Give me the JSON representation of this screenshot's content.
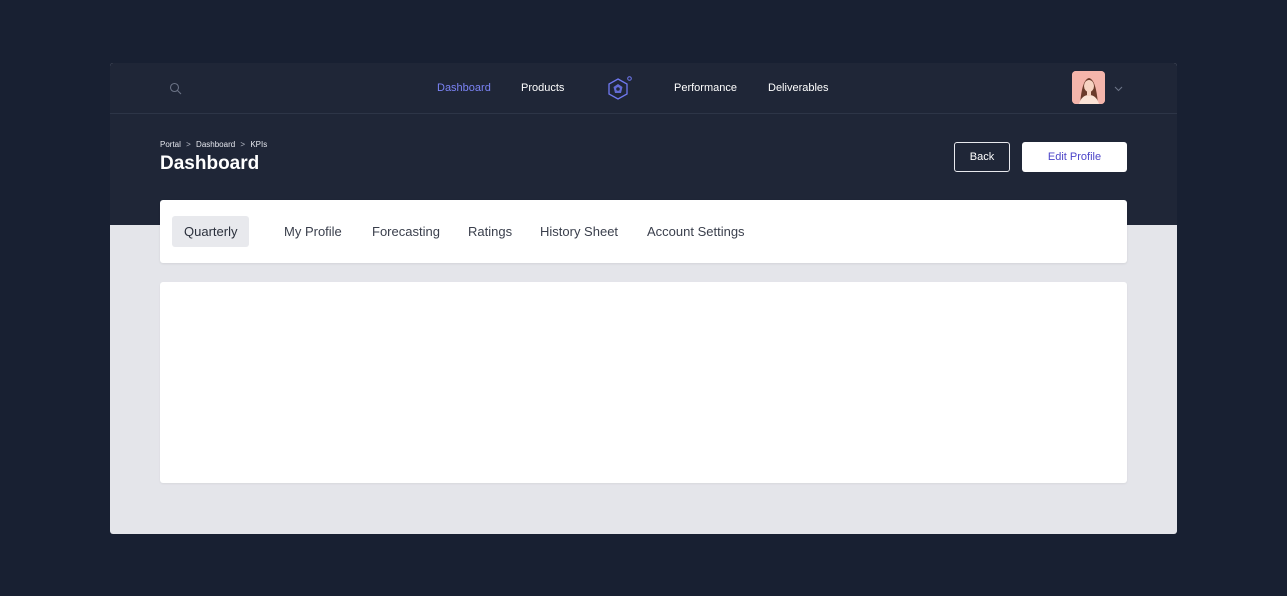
{
  "nav": {
    "links": [
      "Dashboard",
      "Products",
      "Performance",
      "Deliverables"
    ],
    "active": "Dashboard",
    "search_icon": "search-icon",
    "logo_icon": "hexagon-logo-icon",
    "menu_icon": "chevron-down-icon"
  },
  "breadcrumb": [
    "Portal",
    "Dashboard",
    "KPIs"
  ],
  "breadcrumb_separator": ">",
  "page": {
    "title": "Dashboard"
  },
  "buttons": {
    "back": "Back",
    "edit_profile": "Edit Profile"
  },
  "tabs": [
    "Quarterly",
    "My Profile",
    "Forecasting",
    "Ratings",
    "History Sheet",
    "Account Settings"
  ],
  "active_tab": "Quarterly",
  "colors": {
    "background": "#182032",
    "header": "#1f2637",
    "accent": "#7b83f5",
    "edit_button_text": "#4d45c9",
    "content_bg": "#e4e5ea"
  }
}
